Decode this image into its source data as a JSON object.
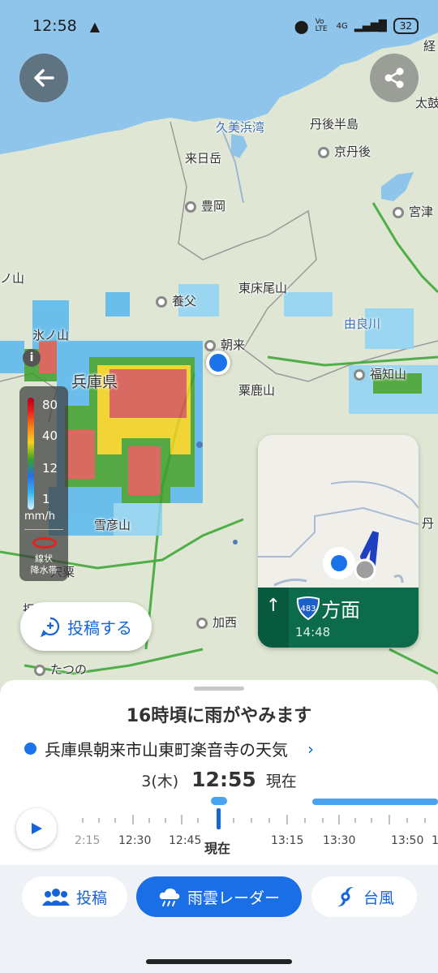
{
  "status_bar": {
    "time": "12:58",
    "battery": "32",
    "network": "4G",
    "volte": "Vo LTE"
  },
  "map_labels": {
    "kumihama": "久美浜湾",
    "tango_peninsula": "丹後半島",
    "kyotango": "京丹後",
    "kunehi": "来日岳",
    "toyooka": "豊岡",
    "miyazu": "宮津",
    "yabu": "養父",
    "higashi_tokoozan": "東床尾山",
    "asago": "朝来",
    "yura": "由良川",
    "hyogo": "兵庫県",
    "fukuchiyama": "福知山",
    "awaga": "粟鹿山",
    "setsuhiko": "雪彦山",
    "shiso": "宍粟",
    "kasai": "加西",
    "tatsuno": "たつの",
    "tan": "丹",
    "hyonosen": "氷ノ山",
    "tai": "太鼓",
    "ke": "経",
    "kuno": "ノ山",
    "ko": "担"
  },
  "legend": {
    "ticks": [
      "80",
      "40",
      "12",
      "1"
    ],
    "unit": "mm/h",
    "linear_band_line1": "線状",
    "linear_band_line2": "降水帯"
  },
  "post_button": {
    "label": "投稿する"
  },
  "nav_card": {
    "route_number": "483",
    "direction": "方面",
    "time": "14:48"
  },
  "sheet": {
    "headline": "16時頃に雨がやみます",
    "location": "兵庫県朝来市山東町楽音寺の天気",
    "date": "3(木)",
    "time": "12:55",
    "now_text": "現在",
    "timeline_labels": [
      "2:15",
      "12:30",
      "12:45",
      "13:15",
      "13:30",
      "13:50",
      "1"
    ],
    "now_marker": "現在"
  },
  "bottom_nav": {
    "post": "投稿",
    "radar": "雨雲レーダー",
    "typhoon": "台風"
  },
  "colors": {
    "accent": "#1a6ee6",
    "nav_green": "#0b6b4a",
    "sea": "#8fc5ea",
    "land": "#dde6d2"
  }
}
